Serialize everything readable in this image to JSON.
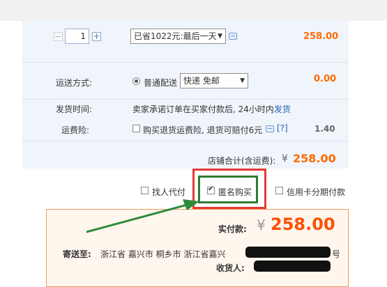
{
  "quantity": {
    "minus": "−",
    "value": "1",
    "plus": "+"
  },
  "discount": {
    "selected": "已省1022元:最后一天",
    "caret": "▼"
  },
  "item_price": "258.00",
  "shipping": {
    "label": "运送方式:",
    "option": "普通配送",
    "method": "快递 免邮",
    "caret": "▼",
    "price": "0.00"
  },
  "delivery": {
    "label": "发货时间:",
    "text": "卖家承诺订单在买家付款后, 24小时内",
    "link": "发货"
  },
  "insurance": {
    "label": "运费险:",
    "text": "购买退货运费险, 退货可赔付6元",
    "help": "[?]",
    "price": "1.40"
  },
  "store_total": {
    "label": "店铺合计(含运费):",
    "currency": "¥",
    "amount": "258.00"
  },
  "pay_options": {
    "proxy": "找人代付",
    "anonymous": "匿名购买",
    "installment": "信用卡分期付款"
  },
  "order": {
    "actual_label": "实付款:",
    "currency": "¥",
    "actual_amount": "258.00",
    "ship_to_label": "寄送至:",
    "ship_to_address": "浙江省 嘉兴市 桐乡市 浙江省嘉兴",
    "ship_to_tail": "号",
    "receiver_label": "收货人:"
  },
  "colors": {
    "accent": "#ff5000",
    "highlight_red": "#e53935",
    "highlight_green": "#2e7d32"
  }
}
